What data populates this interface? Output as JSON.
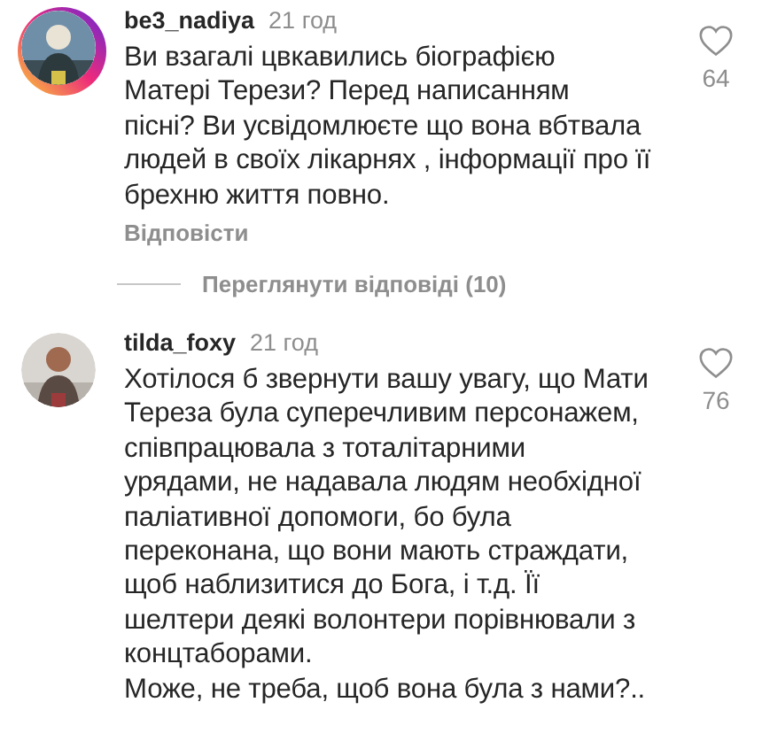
{
  "comments": [
    {
      "username": "be3_nadiya",
      "time": "21 год",
      "story_ring": true,
      "text": "Ви взагалі цвкавились біографією\nМатері Терези? Перед написанням\nпісні? Ви усвідомлюєте що вона вбтвала\nлюдей в своїх лікарнях , інформації про її\nбрехню життя повно.",
      "likes": "64",
      "liked": false,
      "reply": "Відповісти",
      "view_replies": "Переглянути відповіді (10)"
    },
    {
      "username": "tilda_foxy",
      "time": "21 год",
      "story_ring": false,
      "text": "Хотілося б звернути вашу увагу, що Мати\nТереза була суперечливим персонажем,\nспівпрацювала з тоталітарними\nурядами, не надавала людям необхідної\nпаліативної допомоги, бо була\nпереконана, що вони мають страждати,\nщоб наблизитися до Бога, і т.д. Її\nшелтери деякі волонтери порівнювали з\nконцтаборами.\nМоже, не треба, щоб вона була з нами?..",
      "likes": "76",
      "liked": false
    }
  ]
}
